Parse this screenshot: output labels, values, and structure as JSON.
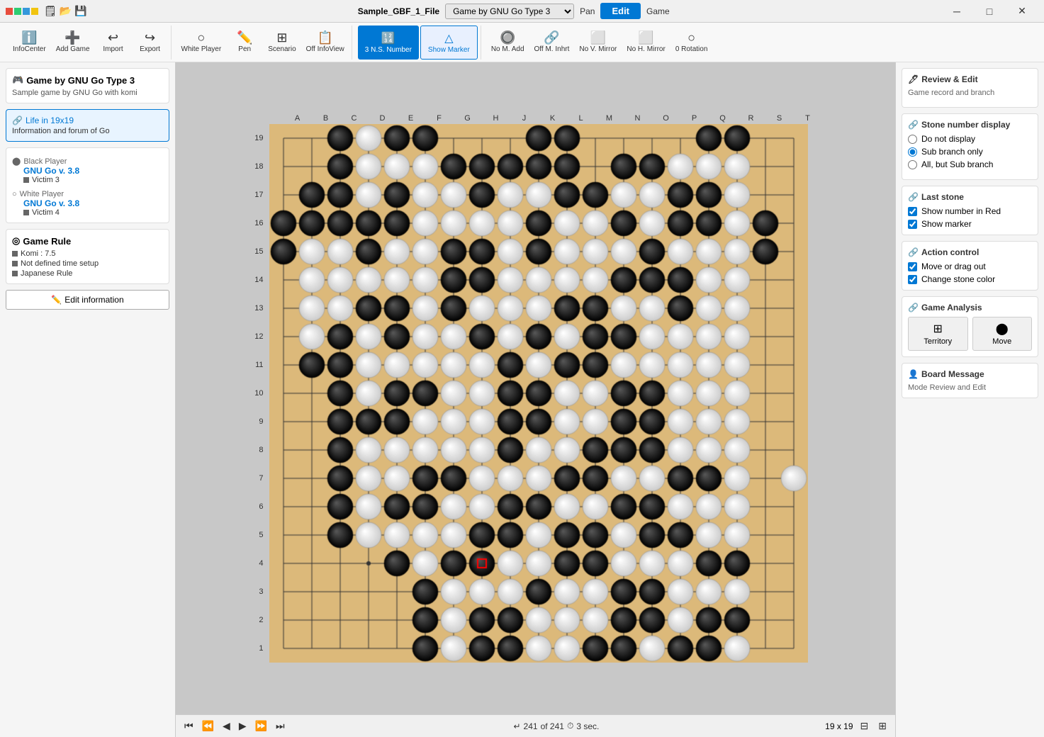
{
  "titleBar": {
    "appName": "Sample_GBF_1_File",
    "gameType": "Game by GNU Go Type 3",
    "panLabel": "Pan",
    "editLabel": "Edit",
    "gameLabel": "Game",
    "minBtn": "─",
    "maxBtn": "□",
    "closeBtn": "✕"
  },
  "toolbar": {
    "infoCenterLabel": "InfoCenter",
    "addGameLabel": "Add Game",
    "importLabel": "Import",
    "exportLabel": "Export",
    "whitePlayerLabel": "White Player",
    "penLabel": "Pen",
    "scenarioLabel": "Scenario",
    "offInfoViewLabel": "Off InfoView",
    "nsNumberLabel": "3 N.S. Number",
    "showMarkerLabel": "Show Marker",
    "noMAddLabel": "No M. Add",
    "offMInhrtLabel": "Off M. Inhrt",
    "noVMirrorLabel": "No V. Mirror",
    "noHMirrorLabel": "No H. Mirror",
    "zeroRotationLabel": "0 Rotation"
  },
  "leftSidebar": {
    "gameTitle": "Game by GNU Go Type 3",
    "gameSubtitle": "Sample game by GNU Go with komi",
    "lifeLink": "Life in 19x19",
    "lifeSubtitle": "Information and forum of Go",
    "blackPlayerLabel": "Black Player",
    "blackPlayerName": "GNU Go v. 3.8",
    "blackRank": "Victim 3",
    "whitePlayerLabel": "White Player",
    "whitePlayerName": "GNU Go v. 3.8",
    "whiteRank": "Victim 4",
    "gameRuleLabel": "Game Rule",
    "komi": "Komi : 7.5",
    "timeSetup": "Not defined time setup",
    "ruleType": "Japanese Rule",
    "editInfoLabel": "Edit information"
  },
  "rightPanel": {
    "reviewEditTitle": "Review & Edit",
    "reviewEditSub": "Game record and branch",
    "stoneNumberTitle": "Stone number display",
    "doNotDisplay": "Do not display",
    "subBranchOnly": "Sub branch only",
    "allButSubBranch": "All, but Sub branch",
    "lastStoneTitle": "Last stone",
    "showNumberInRed": "Show number in Red",
    "showMarker": "Show marker",
    "actionControlTitle": "Action control",
    "moveOrDragOut": "Move or drag out",
    "changeStoneColor": "Change stone color",
    "gameAnalysisTitle": "Game Analysis",
    "territoryLabel": "Territory",
    "moveLabel": "Move",
    "boardMessageTitle": "Board Message",
    "boardMessageSub": "Mode Review and Edit"
  },
  "bottomBar": {
    "moveNumber": "241",
    "ofLabel": "of 241",
    "speedLabel": "3 sec.",
    "boardSize": "19 x 19"
  },
  "board": {
    "cols": [
      "A",
      "B",
      "C",
      "D",
      "E",
      "F",
      "G",
      "H",
      "J",
      "K",
      "L",
      "M",
      "N",
      "O",
      "P",
      "Q",
      "R",
      "S",
      "T"
    ],
    "rows": [
      19,
      18,
      17,
      16,
      15,
      14,
      13,
      12,
      11,
      10,
      9,
      8,
      7,
      6,
      5,
      4,
      3,
      2,
      1
    ]
  }
}
